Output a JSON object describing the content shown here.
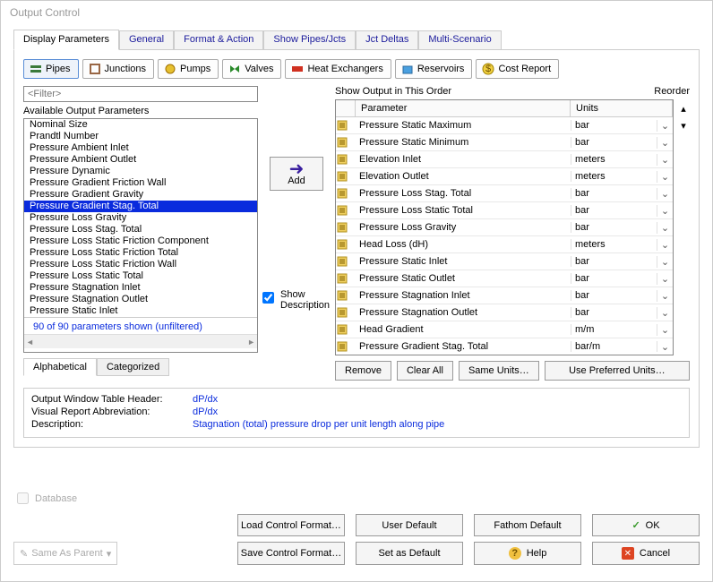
{
  "title": "Output Control",
  "tabs": [
    "Display Parameters",
    "General",
    "Format & Action",
    "Show Pipes/Jcts",
    "Jct Deltas",
    "Multi-Scenario"
  ],
  "activeTab": 0,
  "subtabs": [
    "Pipes",
    "Junctions",
    "Pumps",
    "Valves",
    "Heat Exchangers",
    "Reservoirs",
    "Cost Report"
  ],
  "activeSubtab": 0,
  "filterPlaceholder": "<Filter>",
  "availableLabel": "Available Output Parameters",
  "available": [
    "Nominal Size",
    "Prandtl Number",
    "Pressure Ambient Inlet",
    "Pressure Ambient Outlet",
    "Pressure Dynamic",
    "Pressure Gradient Friction Wall",
    "Pressure Gradient Gravity",
    "Pressure Gradient Stag. Total",
    "Pressure Loss Gravity",
    "Pressure Loss Stag. Total",
    "Pressure Loss Static Friction Component",
    "Pressure Loss Static Friction Total",
    "Pressure Loss Static Friction Wall",
    "Pressure Loss Static Total",
    "Pressure Stagnation Inlet",
    "Pressure Stagnation Outlet",
    "Pressure Static Inlet"
  ],
  "selectedAvailable": "Pressure Gradient Stag. Total",
  "countText": "90 of 90 parameters shown (unfiltered)",
  "sortTabs": [
    "Alphabetical",
    "Categorized"
  ],
  "showDesc": {
    "label": "Show Description",
    "checked": true
  },
  "addLabel": "Add",
  "orderLabel": "Show Output in This Order",
  "reorderLabel": "Reorder",
  "gridHead": {
    "param": "Parameter",
    "units": "Units"
  },
  "gridRows": [
    {
      "p": "Pressure Static Maximum",
      "u": "bar"
    },
    {
      "p": "Pressure Static Minimum",
      "u": "bar"
    },
    {
      "p": "Elevation Inlet",
      "u": "meters"
    },
    {
      "p": "Elevation Outlet",
      "u": "meters"
    },
    {
      "p": "Pressure Loss Stag. Total",
      "u": "bar"
    },
    {
      "p": "Pressure Loss Static Total",
      "u": "bar"
    },
    {
      "p": "Pressure Loss Gravity",
      "u": "bar"
    },
    {
      "p": "Head Loss (dH)",
      "u": "meters"
    },
    {
      "p": "Pressure Static Inlet",
      "u": "bar"
    },
    {
      "p": "Pressure Static Outlet",
      "u": "bar"
    },
    {
      "p": "Pressure Stagnation Inlet",
      "u": "bar"
    },
    {
      "p": "Pressure Stagnation Outlet",
      "u": "bar"
    },
    {
      "p": "Head Gradient",
      "u": "m/m"
    },
    {
      "p": "Pressure Gradient Stag. Total",
      "u": "bar/m"
    }
  ],
  "gridBtns": [
    "Remove",
    "Clear All",
    "Same Units…",
    "Use Preferred Units…"
  ],
  "desc": {
    "k1": "Output Window Table Header:",
    "v1": "dP/dx",
    "k2": "Visual Report Abbreviation:",
    "v2": "dP/dx",
    "k3": "Description:",
    "v3": "Stagnation (total) pressure drop per unit length along pipe"
  },
  "bottom": {
    "database": "Database",
    "sameAs": "Same As Parent",
    "load": "Load Control Format…",
    "save": "Save Control Format…",
    "userDefault": "User Default",
    "setDefault": "Set as Default",
    "fathom": "Fathom Default",
    "help": "Help",
    "ok": "OK",
    "cancel": "Cancel"
  }
}
